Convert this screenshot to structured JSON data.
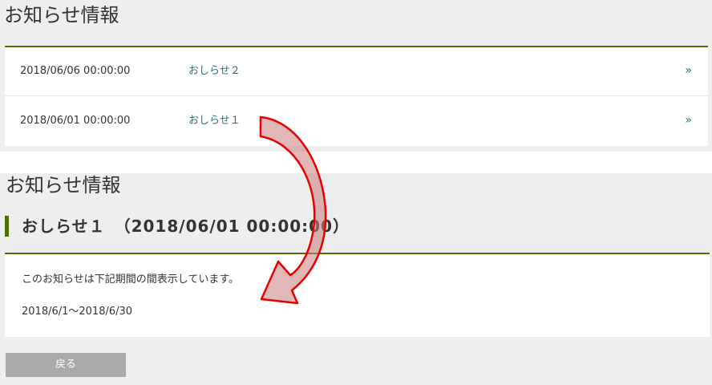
{
  "list_panel": {
    "heading": "お知らせ情報",
    "items": [
      {
        "date": "2018/06/06 00:00:00",
        "title": "おしらせ２",
        "arrow": "»"
      },
      {
        "date": "2018/06/01 00:00:00",
        "title": "おしらせ１",
        "arrow": "»"
      }
    ]
  },
  "detail_panel": {
    "heading": "お知らせ情報",
    "title": "おしらせ１　（2018/06/01 00:00:00）",
    "message": "このお知らせは下記期間の間表示しています。",
    "period": "2018/6/1～2018/6/30",
    "back_label": "戻る"
  },
  "colors": {
    "accent_green": "#4d6e00",
    "link_blue": "#2e6b80",
    "panel_gray": "#eeeeee",
    "button_gray": "#aaaaaa",
    "annotation_red": "#e60000",
    "annotation_fill": "#c97b7b"
  },
  "annotation": {
    "icon": "curved-arrow-icon"
  }
}
